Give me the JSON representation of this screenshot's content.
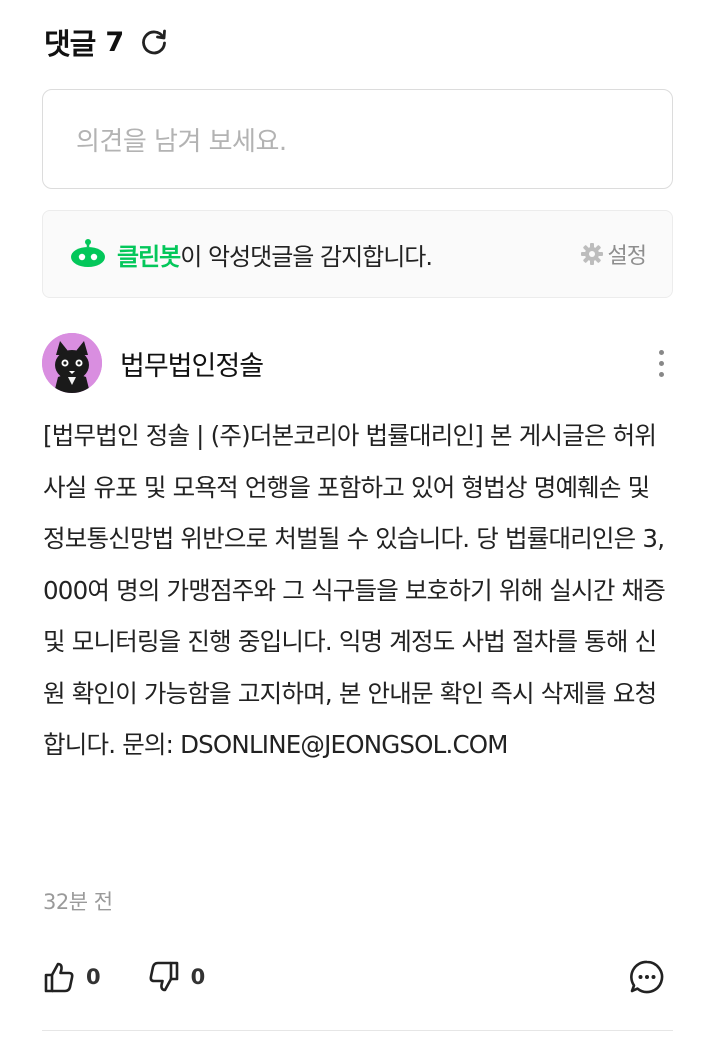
{
  "header": {
    "title": "댓글",
    "count": "7"
  },
  "input": {
    "placeholder": "의견을 남겨 보세요."
  },
  "cleanbot": {
    "name": "클린봇",
    "message": "이 악성댓글을 감지합니다.",
    "settings_label": "설정",
    "accent": "#03c75a"
  },
  "comment": {
    "author": "법무법인정솔",
    "body": "[법무법인 정솔 | (주)더본코리아 법률대리인] 본 게시글은 허위사실 유포 및 모욕적 언행을 포함하고 있어 형법상 명예훼손 및 정보통신망법 위반으로 처벌될 수 있습니다. 당 법률대리인은 3,000여 명의 가맹점주와 그 식구들을 보호하기 위해 실시간 채증 및 모니터링을 진행 중입니다. 익명 계정도 사법 절차를 통해 신원 확인이 가능함을 고지하며, 본 안내문 확인 즉시 삭제를 요청합니다. 문의: DSONLINE@JEONGSOL.COM",
    "time": "32분 전",
    "likes": "0",
    "dislikes": "0"
  },
  "icons": {
    "refresh": "refresh-icon",
    "cleanbot": "cleanbot-robot-icon",
    "settings": "gear-icon",
    "more": "more-vertical-icon",
    "like": "thumbs-up-icon",
    "dislike": "thumbs-down-icon",
    "reply": "chat-bubble-icon"
  }
}
